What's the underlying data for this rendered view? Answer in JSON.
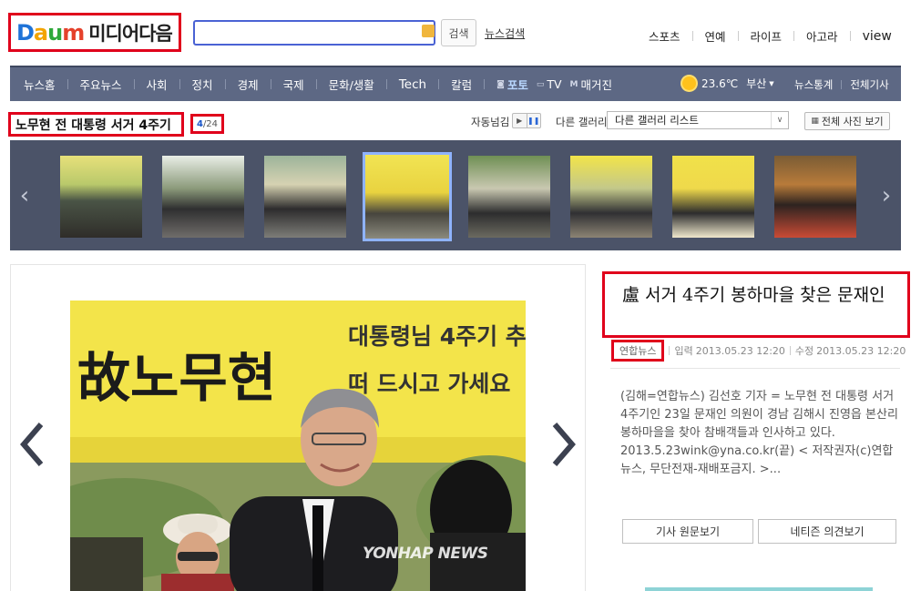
{
  "header": {
    "logo_text": "Daum",
    "logo_subtitle": "미디어다음",
    "search_button": "검색",
    "news_search_link": "뉴스검색",
    "top_links": [
      "스포츠",
      "연예",
      "라이프",
      "아고라",
      "view"
    ]
  },
  "nav": {
    "items": [
      "뉴스홈",
      "주요뉴스",
      "사회",
      "정치",
      "경제",
      "국제",
      "문화/생활",
      "Tech",
      "칼럼",
      "포토",
      "TV",
      "매거진"
    ],
    "active": "포토",
    "weather_temp": "23.6℃",
    "weather_city": "부산",
    "right_links": [
      "뉴스통계",
      "전체기사"
    ]
  },
  "gallery": {
    "title": "노무현 전 대통령 서거 4주기",
    "current": "4",
    "total": "/24",
    "autoplay_label": "자동넘김",
    "other_gallery_label": "다른 갤러리",
    "select_value": "다른 갤러리 리스트",
    "all_photos_button": "전체 사진 보기",
    "selected_index": 4
  },
  "photo": {
    "watermark": "YONHAP NEWS",
    "banner_line1": "대통령님 4주기 추",
    "banner_line2": "떠 드시고 가세요",
    "banner_big": "故노무현"
  },
  "article": {
    "title": "盧 서거 4주기 봉하마을 찾은 문재인",
    "source": "연합뉴스",
    "input_label": "입력",
    "input_time": "2013.05.23 12:20",
    "modified_label": "수정",
    "modified_time": "2013.05.23 12:20",
    "body": "(김해=연합뉴스) 김선호 기자 = 노무현 전 대통령 서거 4주기인 23일 문재인 의원이 경남 김해시 진영읍 본산리 봉하마을을 찾아 참배객들과 인사하고 있다. 2013.5.23wink@yna.co.kr(끝) < 저작권자(c)연합뉴스, 무단전재-재배포금지. >...",
    "button_original": "기사 원문보기",
    "button_comments": "네티즌 의견보기"
  },
  "colors": {
    "nav_bg": "#5d6884",
    "strip_bg": "#4b5368",
    "highlight_red": "#e0001b",
    "active_nav": "#b9d7ff"
  }
}
